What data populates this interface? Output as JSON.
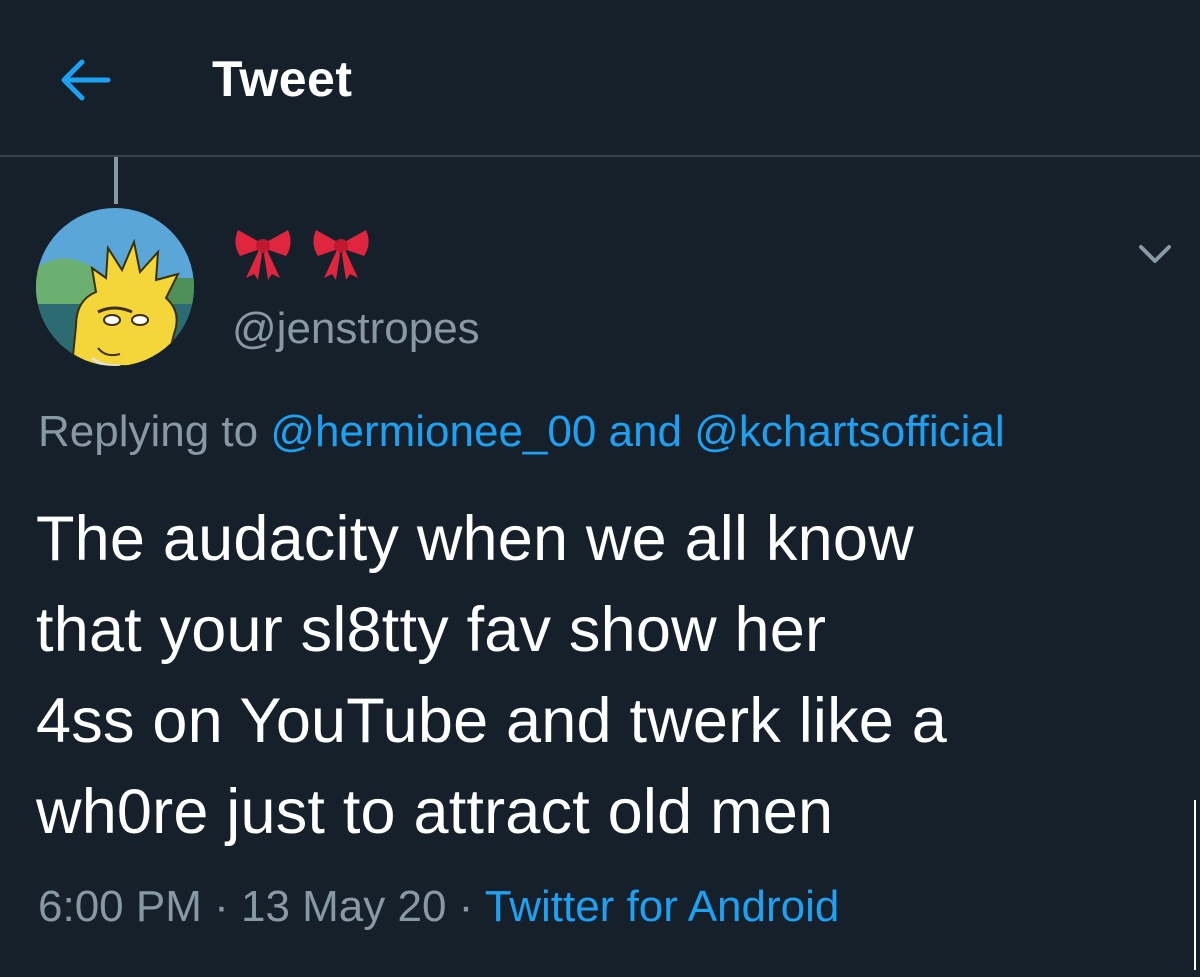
{
  "header": {
    "title": "Tweet",
    "back_icon": "arrow-left-icon",
    "accent_color": "#1da1f2"
  },
  "author": {
    "display_name_icons": [
      "ribbon-icon",
      "ribbon-icon"
    ],
    "handle": "@jenstropes",
    "avatar": "avatar-icon"
  },
  "menu": {
    "icon": "chevron-down-icon"
  },
  "reply": {
    "prefix": "Replying to ",
    "user1": "@hermionee_00",
    "connector": " and ",
    "user2": "@kchartsofficial"
  },
  "tweet": {
    "lines": [
      "The audacity when we all know",
      "that your sl8tty fav show her",
      "4ss on YouTube and twerk like a",
      "wh0re just to attract old men"
    ]
  },
  "meta": {
    "time": "6:00 PM",
    "separator1": " · ",
    "date": "13 May 20",
    "separator2": " · ",
    "source": "Twitter for Android"
  },
  "colors": {
    "background": "#15202b",
    "secondary_text": "#8899a6",
    "link": "#1da1f2",
    "divider": "#38444d"
  }
}
